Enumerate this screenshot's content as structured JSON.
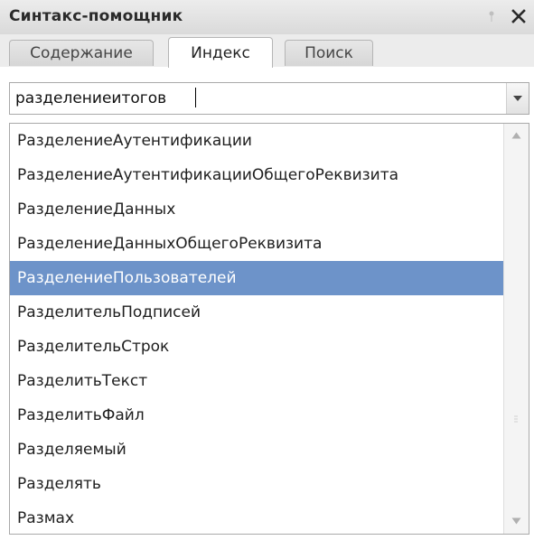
{
  "window": {
    "title": "Синтакс-помощник"
  },
  "tabs": [
    {
      "label": "Содержание",
      "active": false
    },
    {
      "label": "Индекс",
      "active": true
    },
    {
      "label": "Поиск",
      "active": false
    }
  ],
  "search": {
    "value": "разделениеитогов"
  },
  "list": {
    "items": [
      "РазделениеАутентификации",
      "РазделениеАутентификацииОбщегоРеквизита",
      "РазделениеДанных",
      "РазделениеДанныхОбщегоРеквизита",
      "РазделениеПользователей",
      "РазделительПодписей",
      "РазделительСтрок",
      "РазделитьТекст",
      "РазделитьФайл",
      "Разделяемый",
      "Разделять",
      "Размах"
    ],
    "selected_index": 4
  },
  "colors": {
    "selection": "#6d93c9",
    "title_bar": "#dadada"
  },
  "icons": {
    "pin": "pin-icon",
    "close": "close-icon",
    "dropdown": "chevron-down-icon",
    "scroll_up": "scroll-up-arrow-icon",
    "scroll_down": "scroll-down-arrow-icon"
  }
}
